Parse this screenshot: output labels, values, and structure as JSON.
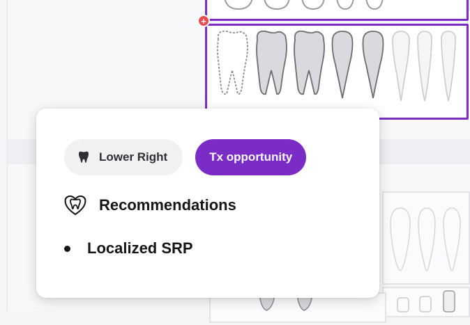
{
  "popup": {
    "location_chip": {
      "label": "Lower Right",
      "icon": "tooth-icon"
    },
    "status_chip": {
      "label": "Tx opportunity"
    },
    "recommendations": {
      "heading": "Recommendations",
      "icon": "heart-tooth-icon",
      "items": [
        "Localized SRP"
      ]
    }
  },
  "colors": {
    "accent_purple": "#7b2cc7",
    "marker_red": "#ea4a4a",
    "chip_gray": "#f0f1f3"
  }
}
